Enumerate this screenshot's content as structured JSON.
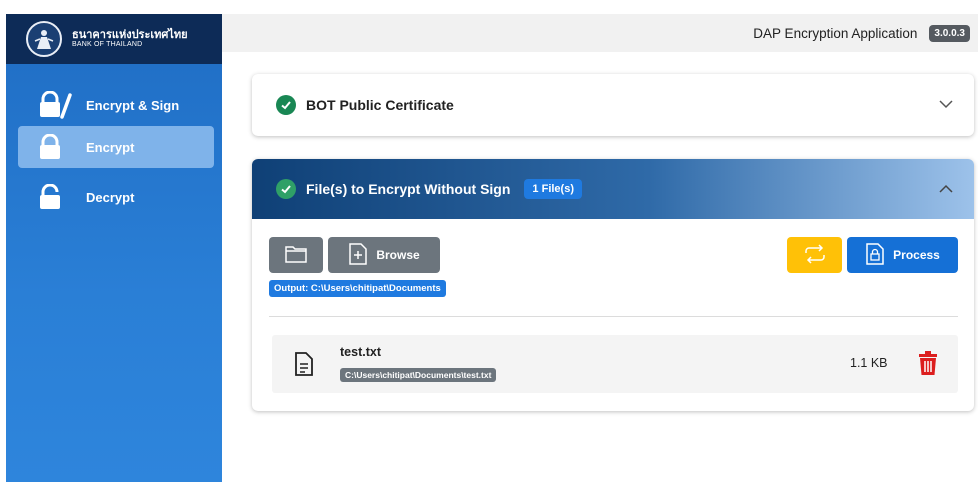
{
  "brand": {
    "name_th": "ธนาคารแห่งประเทศไทย",
    "name_en": "BANK OF THAILAND"
  },
  "header": {
    "title": "DAP Encryption Application",
    "version": "3.0.0.3"
  },
  "sidebar": {
    "items": [
      {
        "label": "Encrypt & Sign",
        "icon": "lock-sign-icon",
        "active": false
      },
      {
        "label": "Encrypt",
        "icon": "lock-icon",
        "active": true
      },
      {
        "label": "Decrypt",
        "icon": "unlock-icon",
        "active": false
      }
    ]
  },
  "certificate_panel": {
    "title": "BOT Public Certificate",
    "status_icon": "check-circle-icon"
  },
  "files_panel": {
    "title": "File(s) to Encrypt Without Sign",
    "count_badge": "1 File(s)",
    "browse_label": "Browse",
    "process_label": "Process",
    "output_label": "Output: C:\\Users\\chitipat\\Documents",
    "files": [
      {
        "name": "test.txt",
        "path": "C:\\Users\\chitipat\\Documents\\test.txt",
        "size": "1.1 KB"
      }
    ]
  },
  "colors": {
    "sidebar": "#2a7fd6",
    "brand_bar": "#0d2b57",
    "success": "#198754",
    "warning": "#ffc107",
    "primary": "#1570d6",
    "secondary": "#6c757d",
    "danger": "#dc1e1e"
  }
}
